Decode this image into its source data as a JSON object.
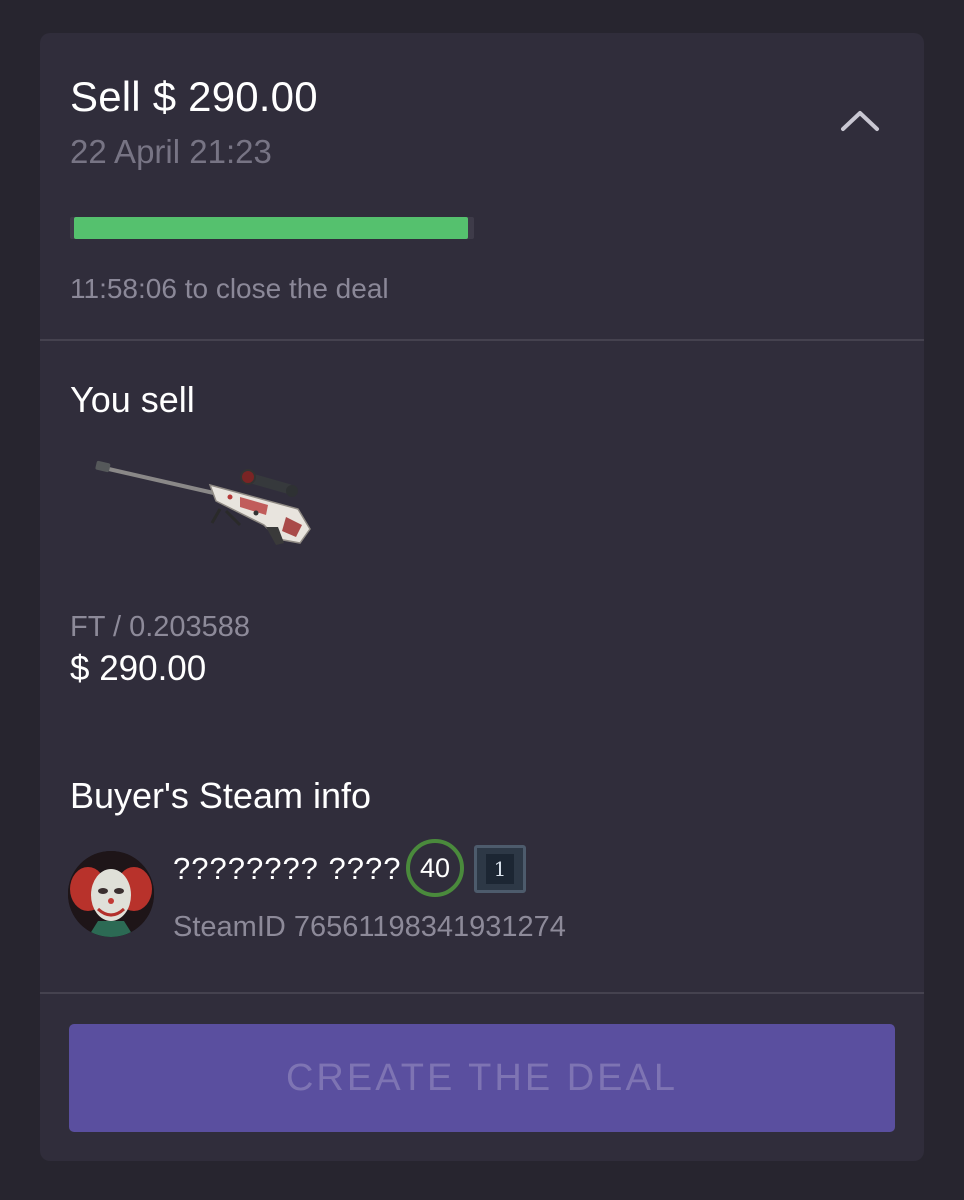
{
  "deal": {
    "title": "Sell $ 290.00",
    "date": "22 April 21:23",
    "countdown": "11:58:06 to close the deal",
    "time_progress": 0.99
  },
  "you_sell": {
    "section_title": "You sell",
    "item_icon": "awp-rifle-skin",
    "wear": "FT / 0.203588",
    "price": "$ 290.00"
  },
  "buyer": {
    "section_title": "Buyer's Steam info",
    "avatar_icon": "clown-avatar",
    "name": "???????? ????",
    "level": "40",
    "badge_count": "1",
    "steam_id": "SteamID 76561198341931274"
  },
  "actions": {
    "create_label": "CREATE THE DEAL"
  },
  "colors": {
    "background": "#27252f",
    "card": "#302d3b",
    "progress": "#55c16e",
    "button": "#5a4f9f",
    "button_text": "#7e74b3"
  }
}
